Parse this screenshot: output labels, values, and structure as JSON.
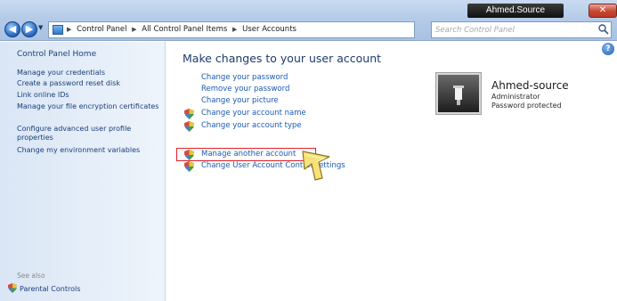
{
  "window": {
    "title": "Ahmed.Source",
    "close_glyph": "✕"
  },
  "address": {
    "crumbs": [
      "Control Panel",
      "All Control Panel Items",
      "User Accounts"
    ],
    "refresh_glyph": "↻"
  },
  "search": {
    "placeholder": "Search Control Panel"
  },
  "sidebar": {
    "home": "Control Panel Home",
    "items": [
      {
        "label": "Manage your credentials"
      },
      {
        "label": "Create a password reset disk"
      },
      {
        "label": "Link online IDs"
      },
      {
        "label": "Manage your file encryption certificates"
      },
      {
        "label": "Configure advanced user profile properties"
      },
      {
        "label": "Change my environment variables"
      }
    ],
    "see_also": "See also",
    "parental_controls": "Parental Controls"
  },
  "main": {
    "title": "Make changes to your user account",
    "tasks": [
      {
        "label": "Change your password",
        "shield": false
      },
      {
        "label": "Remove your password",
        "shield": false
      },
      {
        "label": "Change your picture",
        "shield": false
      },
      {
        "label": "Change your account name",
        "shield": true
      },
      {
        "label": "Change your account type",
        "shield": true
      }
    ],
    "other_tasks": [
      {
        "label": "Manage another account",
        "shield": true
      },
      {
        "label": "Change User Account Control settings",
        "shield": true
      }
    ]
  },
  "user": {
    "name": "Ahmed-source",
    "role": "Administrator",
    "status": "Password protected"
  },
  "icons": {
    "shield": "uac-shield-icon",
    "help": "help-icon",
    "cursor": "hand-pointer-icon"
  },
  "colors": {
    "link": "#1a5ab4",
    "highlight_box": "#e0202a"
  }
}
